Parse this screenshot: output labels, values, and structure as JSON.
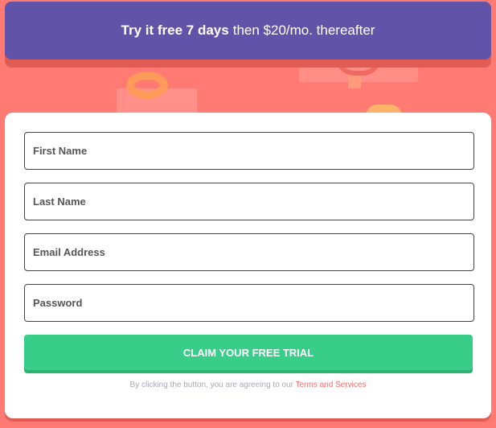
{
  "banner": {
    "bold_text": "Try it free 7 days",
    "rest_text": "then $20/mo. thereafter"
  },
  "form": {
    "first_name_placeholder": "First Name",
    "last_name_placeholder": "Last Name",
    "email_placeholder": "Email Address",
    "password_placeholder": "Password",
    "submit_label": "CLAIM YOUR FREE TRIAL",
    "disclaimer_text": "By clicking the button, you are agreeing to our",
    "terms_link": "Terms and Services"
  },
  "colors": {
    "background": "#ff7a73",
    "banner": "#6154a8",
    "button": "#38cd88",
    "link": "#ff6b6b"
  }
}
